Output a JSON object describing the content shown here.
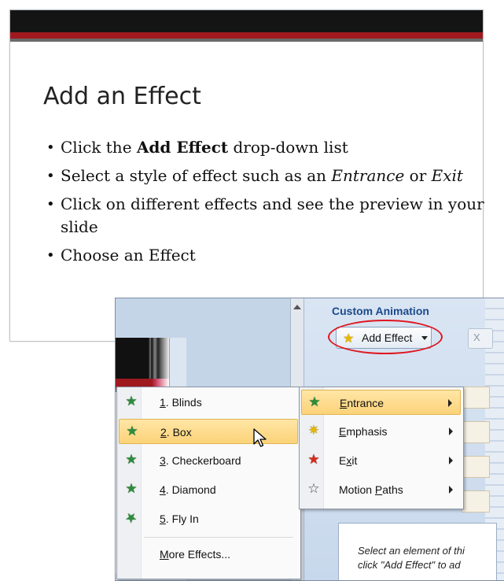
{
  "slide": {
    "title": "Add an Effect",
    "bullets": [
      {
        "parts": [
          {
            "text": "Click the ",
            "style": "normal"
          },
          {
            "text": "Add Effect",
            "style": "bold"
          },
          {
            "text": " drop-down list",
            "style": "normal"
          }
        ]
      },
      {
        "parts": [
          {
            "text": "Select a style of effect such as an ",
            "style": "normal"
          },
          {
            "text": "Entrance",
            "style": "italic"
          },
          {
            "text": " or ",
            "style": "normal"
          },
          {
            "text": "Exit",
            "style": "italic"
          }
        ]
      },
      {
        "parts": [
          {
            "text": "Click on different effects and see the preview in your slide",
            "style": "normal"
          }
        ]
      },
      {
        "parts": [
          {
            "text": "Choose an Effect",
            "style": "normal"
          }
        ]
      }
    ],
    "colors": {
      "band_top": "#141414",
      "band_accent": "#a0191f"
    }
  },
  "taskpane": {
    "title": "Custom Animation",
    "add_effect_label": "Add Effect",
    "add_effect_icon": "star-effect-icon",
    "remove_label": "X",
    "note_line1": "Select an element of thi",
    "note_line2": "click \"Add Effect\" to ad",
    "highlight_color": "#e0161f"
  },
  "effect_menu": {
    "items": [
      {
        "accel": "E",
        "rest": "ntrance",
        "icon": "entrance-star-icon",
        "has_submenu": true,
        "highlighted": true
      },
      {
        "accel": "E",
        "rest": "mphasis",
        "icon": "emphasis-star-icon",
        "has_submenu": true,
        "highlighted": false
      },
      {
        "accel": "x",
        "pre": "E",
        "rest": "it",
        "icon": "exit-star-icon",
        "has_submenu": true,
        "highlighted": false
      },
      {
        "pre": "Motion ",
        "accel": "P",
        "rest": "aths",
        "icon": "motion-path-star-icon",
        "has_submenu": true,
        "highlighted": false
      }
    ]
  },
  "entrance_submenu": {
    "items": [
      {
        "accel": "1",
        "rest": ". Blinds",
        "icon": "blinds-effect-icon",
        "highlighted": false
      },
      {
        "accel": "2",
        "rest": ". Box",
        "icon": "box-effect-icon",
        "highlighted": true
      },
      {
        "accel": "3",
        "rest": ". Checkerboard",
        "icon": "checkerboard-effect-icon",
        "highlighted": false
      },
      {
        "accel": "4",
        "rest": ". Diamond",
        "icon": "diamond-effect-icon",
        "highlighted": false
      },
      {
        "accel": "5",
        "rest": ". Fly In",
        "icon": "fly-in-effect-icon",
        "highlighted": false
      }
    ],
    "more_accel": "M",
    "more_rest": "ore Effects..."
  }
}
